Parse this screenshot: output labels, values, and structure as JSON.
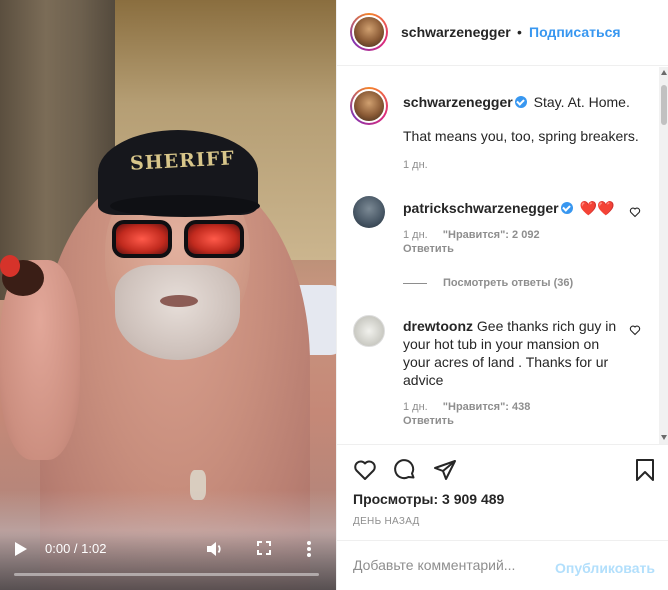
{
  "video": {
    "cap_text": "SHERIFF",
    "time_display": "0:00 / 1:02",
    "progress": 0.0
  },
  "post": {
    "author": "schwarzenegger",
    "separator": "•",
    "follow_label": "Подписаться",
    "caption_text": "Stay. At. Home.",
    "caption_line2": "That means you, too, spring breakers.",
    "caption_time": "1 дн."
  },
  "comments": [
    {
      "username": "patrickschwarzenegger",
      "verified": true,
      "text": "❤️❤️",
      "time": "1 дн.",
      "likes": "\"Нравится\": 2 092",
      "reply_label": "Ответить"
    },
    {
      "username": "drewtoonz",
      "verified": false,
      "text": "Gee thanks rich guy in your hot tub in your mansion on your acres of land . Thanks for ur advice",
      "time": "1 дн.",
      "likes": "\"Нравится\": 438",
      "reply_label": "Ответить"
    }
  ],
  "view_replies": "Посмотреть ответы (36)",
  "stats": {
    "views": "Просмотры: 3 909 489",
    "posted": "ДЕНЬ НАЗАД"
  },
  "add_comment": {
    "placeholder": "Добавьте комментарий...",
    "post_label": "Опубликовать"
  },
  "icons": {
    "play": "play-icon",
    "volume": "volume-icon",
    "fullscreen": "fullscreen-icon",
    "more": "more-vertical-icon",
    "like": "heart-icon",
    "comment": "comment-icon",
    "share": "share-icon",
    "save": "bookmark-icon"
  },
  "colors": {
    "link": "#3897f0",
    "muted": "#8e8e8e",
    "post_disabled": "#b2dffc"
  }
}
